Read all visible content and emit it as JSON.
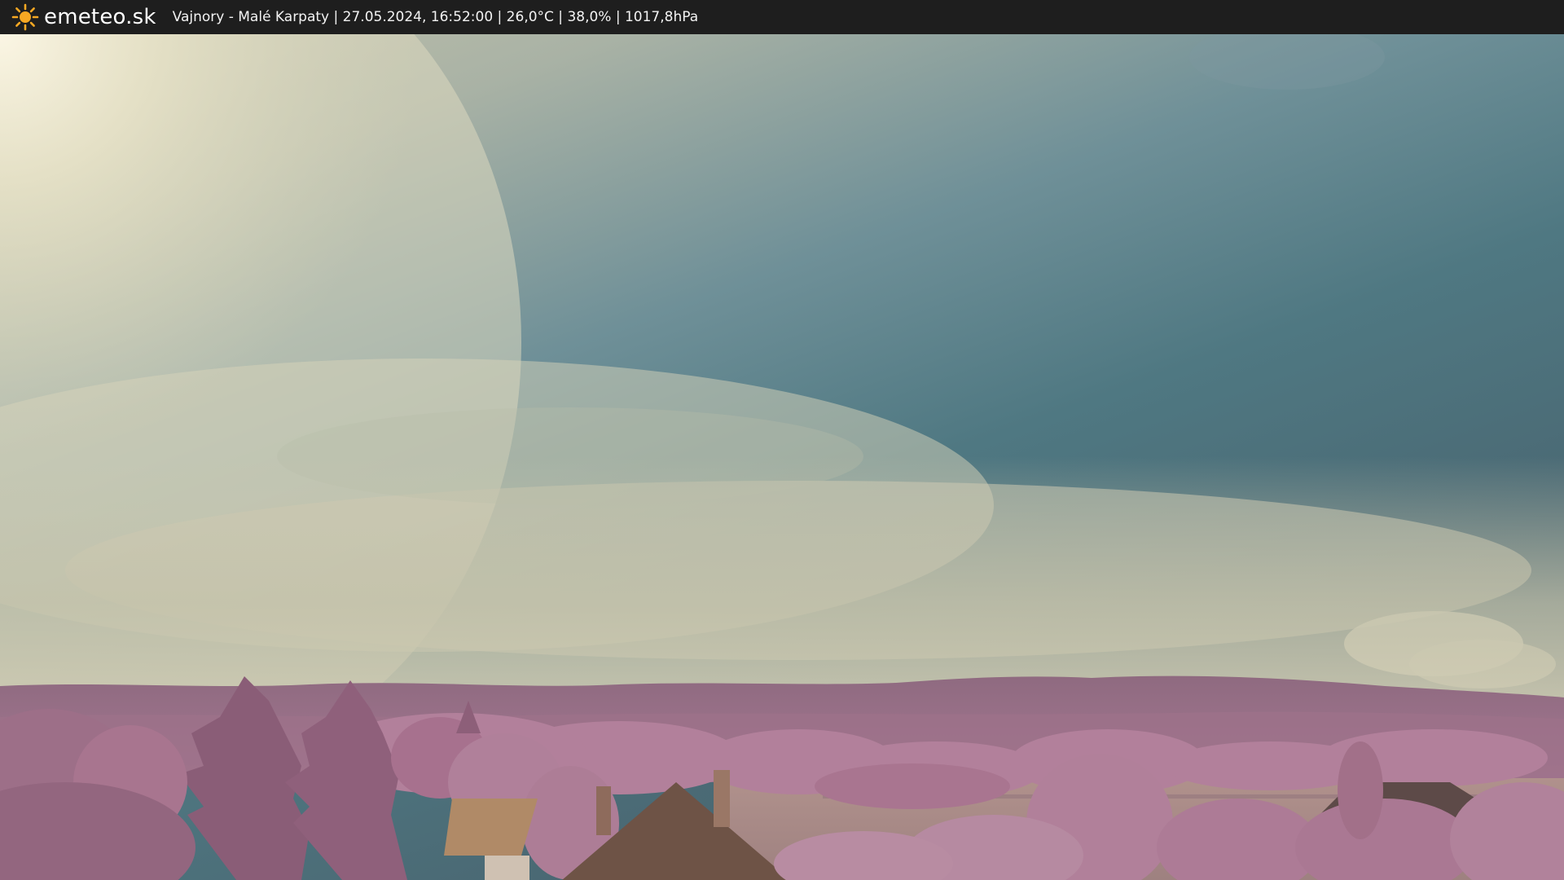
{
  "brand": {
    "logo_text": "emeteo.sk",
    "logo_icon": "sun-icon",
    "logo_color": "#f7a823"
  },
  "status": {
    "text": "Vajnory - Malé Karpaty | 27.05.2024, 16:52:00 | 26,0°C | 38,0% | 1017,8hPa"
  },
  "colors": {
    "topbar_background": "#1e1e1e",
    "sky_bright": "#f3eccf",
    "sky_blue": "#4f7882",
    "hills": "#9a6f86",
    "trees": "#b07a98",
    "field": "#a88a86",
    "roof": "#6e5346"
  }
}
